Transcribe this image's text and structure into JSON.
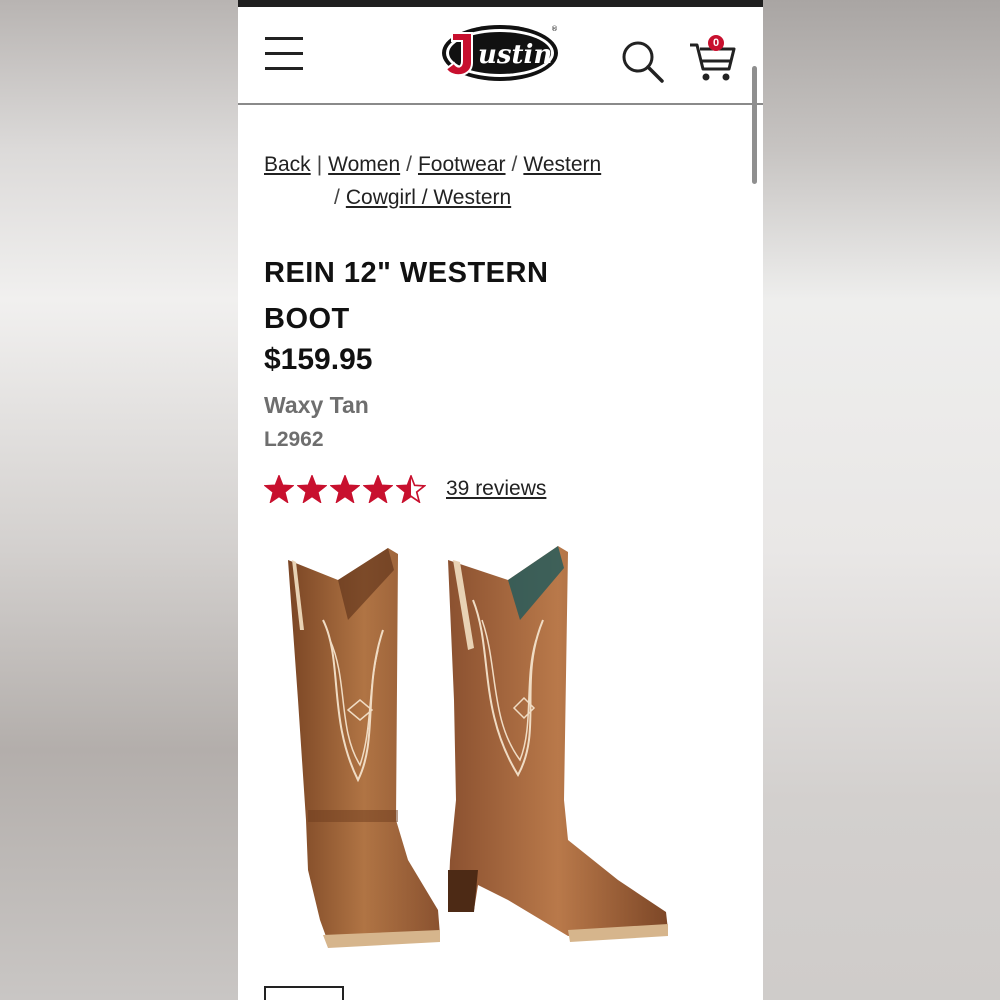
{
  "header": {
    "logo_text": "Justin",
    "cart_count": "0",
    "icons": [
      "menu-icon",
      "search-icon",
      "cart-icon"
    ]
  },
  "breadcrumb": {
    "items": [
      "Back",
      "Women",
      "Footwear",
      "Western",
      "Cowgirl / Western"
    ],
    "separator_first": "|",
    "separator": "/"
  },
  "product": {
    "title": "REIN 12\" WESTERN BOOT",
    "price": "$159.95",
    "color": "Waxy Tan",
    "sku": "L2962",
    "rating": 4.5,
    "rating_max": 5,
    "reviews_label": "39 reviews"
  },
  "colors": {
    "brand_red": "#c8102e",
    "text": "#111111",
    "muted": "#6e6e6e",
    "boot_brown": "#a0633a"
  }
}
